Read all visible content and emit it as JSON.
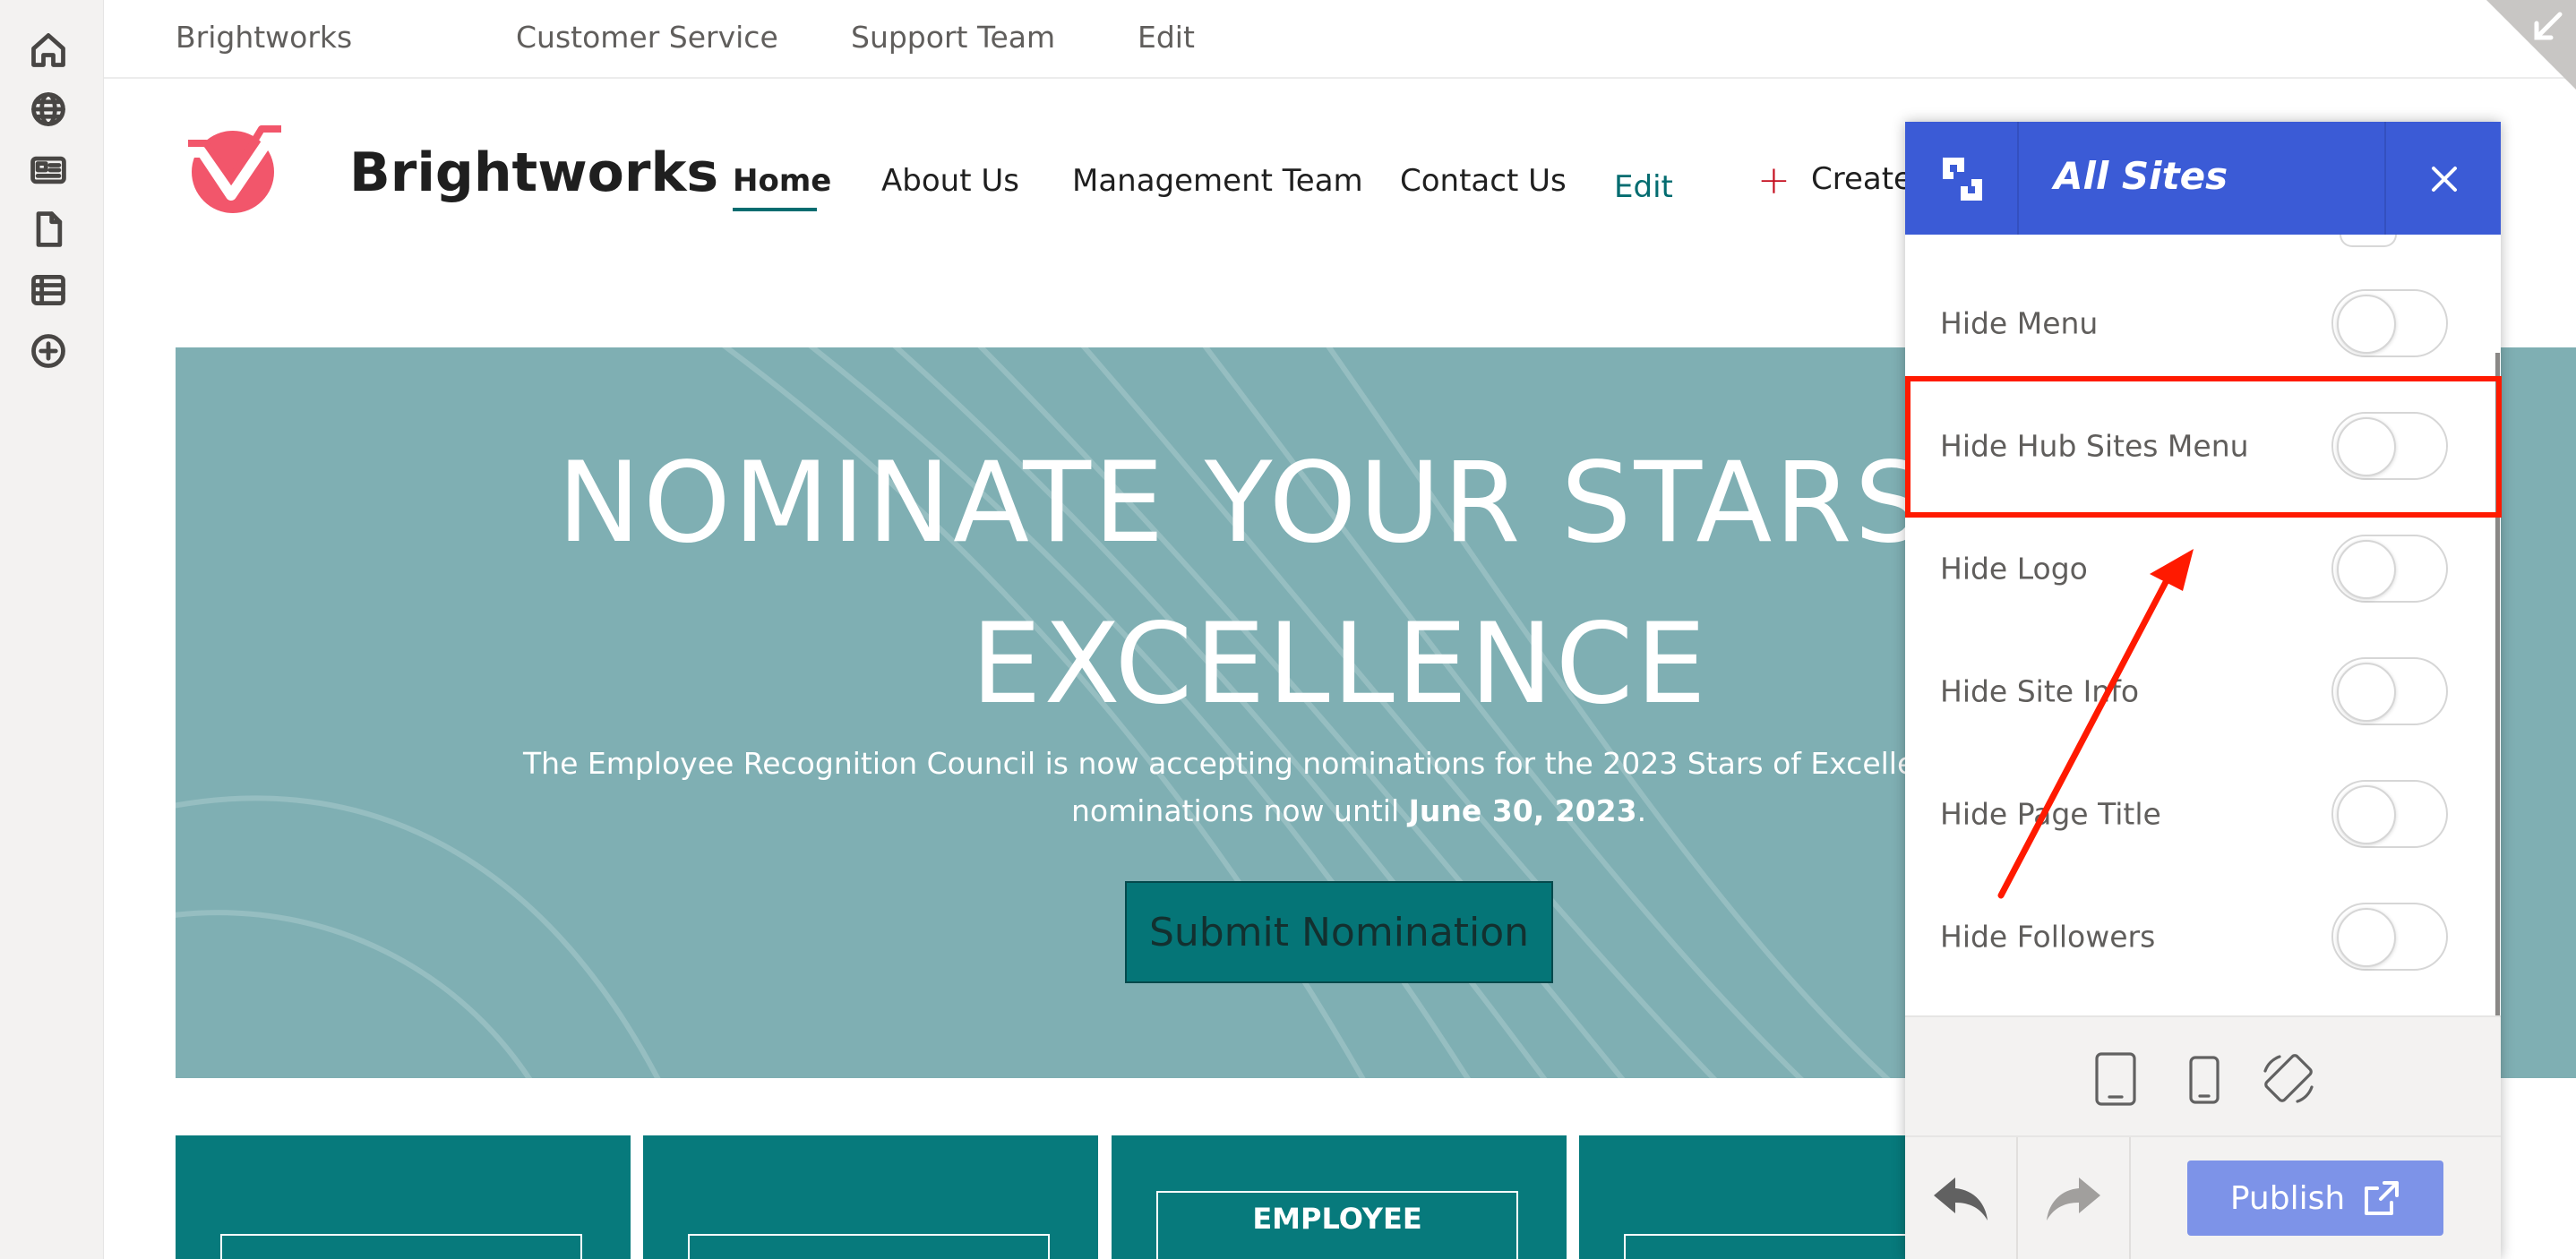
{
  "hub_bar": {
    "items": [
      "Brightworks",
      "Customer Service",
      "Support Team",
      "Edit"
    ]
  },
  "site": {
    "title": "Brightworks",
    "nav": [
      "Home",
      "About Us",
      "Management Team",
      "Contact Us"
    ],
    "nav_edit": "Edit",
    "create_label": "Create"
  },
  "hero": {
    "title_line1": "NOMINATE YOUR STARS OF",
    "title_line2": "EXCELLENCE",
    "text_line1": "The Employee Recognition Council is now accepting nominations for the 2023 Stars of Excellence Awards. Submit",
    "text_line2_prefix": "nominations now until ",
    "text_line2_bold": "June 30, 2023",
    "text_line2_suffix": ".",
    "button_label": "Submit Nomination"
  },
  "tiles": [
    {
      "label": ""
    },
    {
      "label": ""
    },
    {
      "label": "EMPLOYEE"
    },
    {
      "label": ""
    }
  ],
  "panel": {
    "title": "All Sites",
    "toggles": [
      {
        "label": "Hide Menu",
        "on": false
      },
      {
        "label": "Hide Hub Sites Menu",
        "on": false
      },
      {
        "label": "Hide Logo",
        "on": false
      },
      {
        "label": "Hide Site Info",
        "on": false
      },
      {
        "label": "Hide Page Title",
        "on": false
      },
      {
        "label": "Hide Followers",
        "on": false
      }
    ],
    "publish_label": "Publish"
  },
  "colors": {
    "panel_header": "#3b5bd6",
    "publish_button": "#7d93e8",
    "accent_teal": "#036c70",
    "hero_bg": "#7fafb3",
    "highlight": "#ff1a00",
    "logo": "#f2566b"
  },
  "icons": {
    "rail": [
      "home-icon",
      "globe-icon",
      "news-icon",
      "document-icon",
      "list-icon",
      "add-circle-icon"
    ],
    "devices": [
      "tablet-icon",
      "phone-icon",
      "rotate-device-icon"
    ],
    "actions": [
      "undo-icon",
      "redo-icon",
      "open-external-icon"
    ]
  }
}
